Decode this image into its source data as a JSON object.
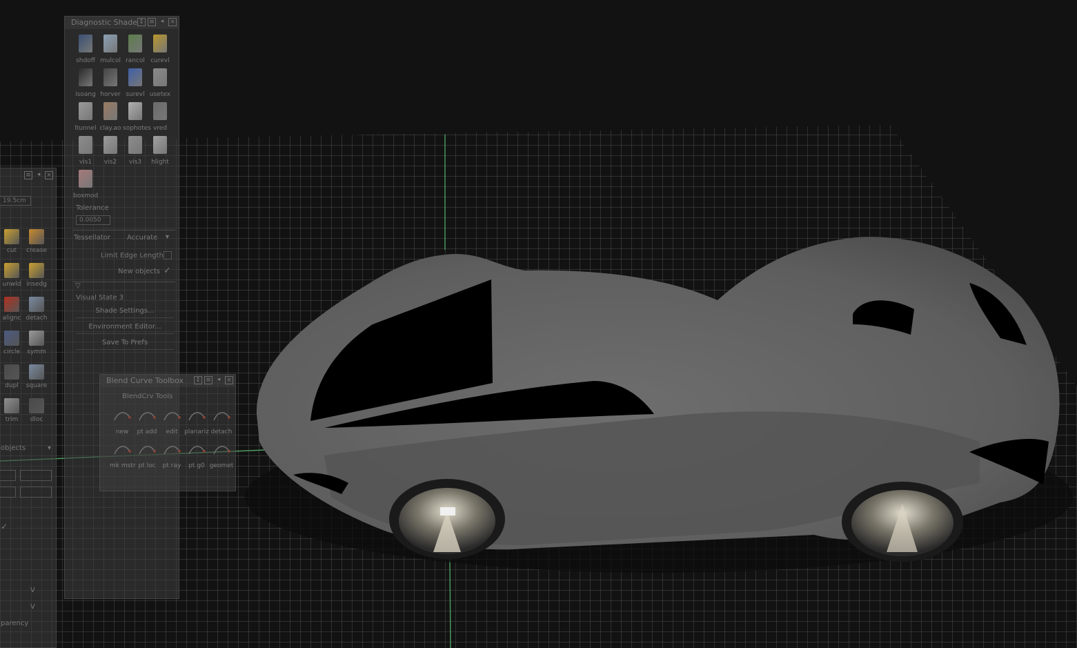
{
  "diagnostic_shade": {
    "title": "Diagnostic Shade",
    "tools": [
      {
        "label": "shdoff",
        "icon": "shading-off-icon",
        "color": "#3a4f73"
      },
      {
        "label": "mulcol",
        "icon": "multi-color-icon",
        "color": "#8aa0b6"
      },
      {
        "label": "rancol",
        "icon": "random-color-icon",
        "color": "#5b7d4a"
      },
      {
        "label": "curevl",
        "icon": "curvature-eval-icon",
        "color": "#b9962c"
      },
      {
        "label": "isoang",
        "icon": "isoangle-icon",
        "color": "#2a2a2a"
      },
      {
        "label": "horver",
        "icon": "horizontal-vertical-icon",
        "color": "#444444"
      },
      {
        "label": "surevl",
        "icon": "surface-eval-icon",
        "color": "#3f5fa8"
      },
      {
        "label": "usetex",
        "icon": "use-texture-icon",
        "color": "#8a8a8a"
      },
      {
        "label": "ltunnel",
        "icon": "light-tunnel-icon",
        "color": "#9a9a9a"
      },
      {
        "label": "clay.ao",
        "icon": "clay-ao-icon",
        "color": "#9a7a62"
      },
      {
        "label": "sophotes",
        "icon": "isophotes-icon",
        "color": "#b0b0b0"
      },
      {
        "label": "vred",
        "icon": "vred-icon",
        "color": "#6b6b6b"
      },
      {
        "label": "vis1",
        "icon": "visual-1-icon",
        "color": "#8c8c8c"
      },
      {
        "label": "vis2",
        "icon": "visual-2-icon",
        "color": "#9a9a9a"
      },
      {
        "label": "vis3",
        "icon": "visual-3-icon",
        "color": "#8c8c8c"
      },
      {
        "label": "hlight",
        "icon": "highlight-icon",
        "color": "#a0a0a0"
      },
      {
        "label": "boxmod",
        "icon": "box-mode-icon",
        "color": "#a67a7a"
      }
    ],
    "tolerance_label": "Tolerance",
    "tolerance_value": "0.0050",
    "tessellator_label": "Tessellator",
    "tessellator_value": "Accurate",
    "limit_edge_label": "Limit Edge Length",
    "new_objects_label": "New objects",
    "new_objects_checked": true,
    "visual_state": "Visual State 3",
    "buttons": [
      "Shade Settings...",
      "Environment Editor...",
      "Save To Prefs"
    ]
  },
  "left_palette": {
    "field_value": "19.5cm",
    "tools": [
      {
        "label": "cut",
        "icon": "cut-icon",
        "color": "#c9a030"
      },
      {
        "label": "crease",
        "icon": "crease-icon",
        "color": "#c98a30"
      },
      {
        "label": "unwld",
        "icon": "unweld-icon",
        "color": "#c9a030"
      },
      {
        "label": "insedg",
        "icon": "insert-edge-icon",
        "color": "#c9a030"
      },
      {
        "label": "alignc",
        "icon": "align-curve-icon",
        "color": "#b03020"
      },
      {
        "label": "detach",
        "icon": "detach-icon",
        "color": "#7a8aa0"
      },
      {
        "label": "circle",
        "icon": "circle-icon",
        "color": "#4a5a80"
      },
      {
        "label": "symm",
        "icon": "symmetry-icon",
        "color": "#9a9a9a"
      },
      {
        "label": "dupl",
        "icon": "duplicate-icon",
        "color": "#4a4a4a"
      },
      {
        "label": "square",
        "icon": "square-icon",
        "color": "#7a8aa0"
      },
      {
        "label": "trim",
        "icon": "trim-icon",
        "color": "#909090"
      },
      {
        "label": "dloc",
        "icon": "dloc-icon",
        "color": "#4a4a4a"
      }
    ],
    "objects_label": "objects",
    "v_label_1": "V",
    "v_label_2": "V",
    "transparency_label": "parency"
  },
  "blend_curve_toolbox": {
    "title": "Blend Curve Toolbox",
    "subtitle": "BlendCrv Tools",
    "tools": [
      {
        "label": "new",
        "icon": "blend-new-icon"
      },
      {
        "label": "pt add",
        "icon": "point-add-icon"
      },
      {
        "label": "edit",
        "icon": "blend-edit-icon"
      },
      {
        "label": "planariz",
        "icon": "planarize-icon"
      },
      {
        "label": "detach",
        "icon": "blend-detach-icon"
      },
      {
        "label": "mk mstr",
        "icon": "make-master-icon"
      },
      {
        "label": "pt loc",
        "icon": "point-locator-icon"
      },
      {
        "label": "pt ray",
        "icon": "point-ray-icon"
      },
      {
        "label": "pt g0",
        "icon": "point-g0-icon"
      },
      {
        "label": "geomet",
        "icon": "geometry-icon"
      }
    ]
  },
  "colors": {
    "background": "#121212",
    "grid_line": "#5a5a5a",
    "axis_green": "#4f9f62",
    "car_body": "#666666",
    "glass": "#000000"
  }
}
